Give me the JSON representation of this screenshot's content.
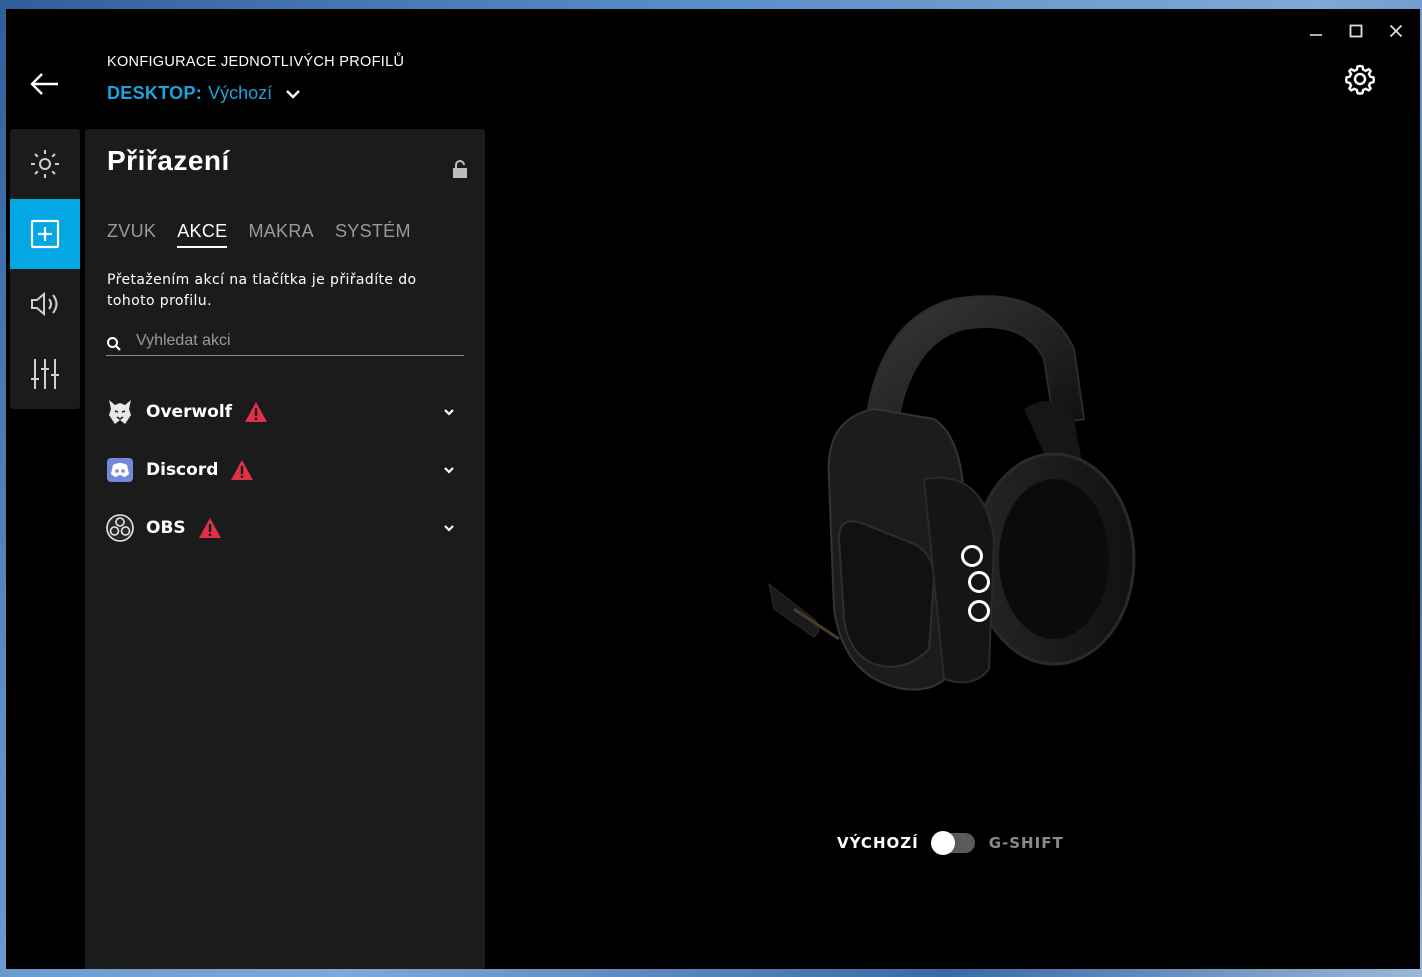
{
  "header": {
    "subtitle": "KONFIGURACE JEDNOTLIVÝCH PROFILŮ",
    "profile_label": "DESKTOP:",
    "profile_name": "Výchozí"
  },
  "rail": {
    "items": [
      {
        "name": "lighting",
        "icon": "sun-icon",
        "active": false
      },
      {
        "name": "assignments",
        "icon": "plus-square-icon",
        "active": true
      },
      {
        "name": "sound",
        "icon": "speaker-icon",
        "active": false
      },
      {
        "name": "equalizer",
        "icon": "equalizer-sliders-icon",
        "active": false
      }
    ]
  },
  "panel": {
    "title": "Přiřazení",
    "tabs": [
      {
        "label": "ZVUK",
        "active": false
      },
      {
        "label": "AKCE",
        "active": true
      },
      {
        "label": "MAKRA",
        "active": false
      },
      {
        "label": "SYSTÉM",
        "active": false
      }
    ],
    "instruction": "Přetažením akcí na tlačítka je přiřadíte do tohoto profilu.",
    "search_placeholder": "Vyhledat akci",
    "apps": [
      {
        "name": "Overwolf",
        "icon": "overwolf-icon",
        "warning": true
      },
      {
        "name": "Discord",
        "icon": "discord-icon",
        "warning": true
      },
      {
        "name": "OBS",
        "icon": "obs-icon",
        "warning": true
      }
    ]
  },
  "toggle": {
    "left_label": "VÝCHOZÍ",
    "right_label": "G-SHIFT",
    "state": "VÝCHOZÍ"
  },
  "colors": {
    "accent": "#03a7e4",
    "warning": "#e0304a",
    "panel_bg": "#1b1b1b",
    "window_bg": "#000000"
  }
}
